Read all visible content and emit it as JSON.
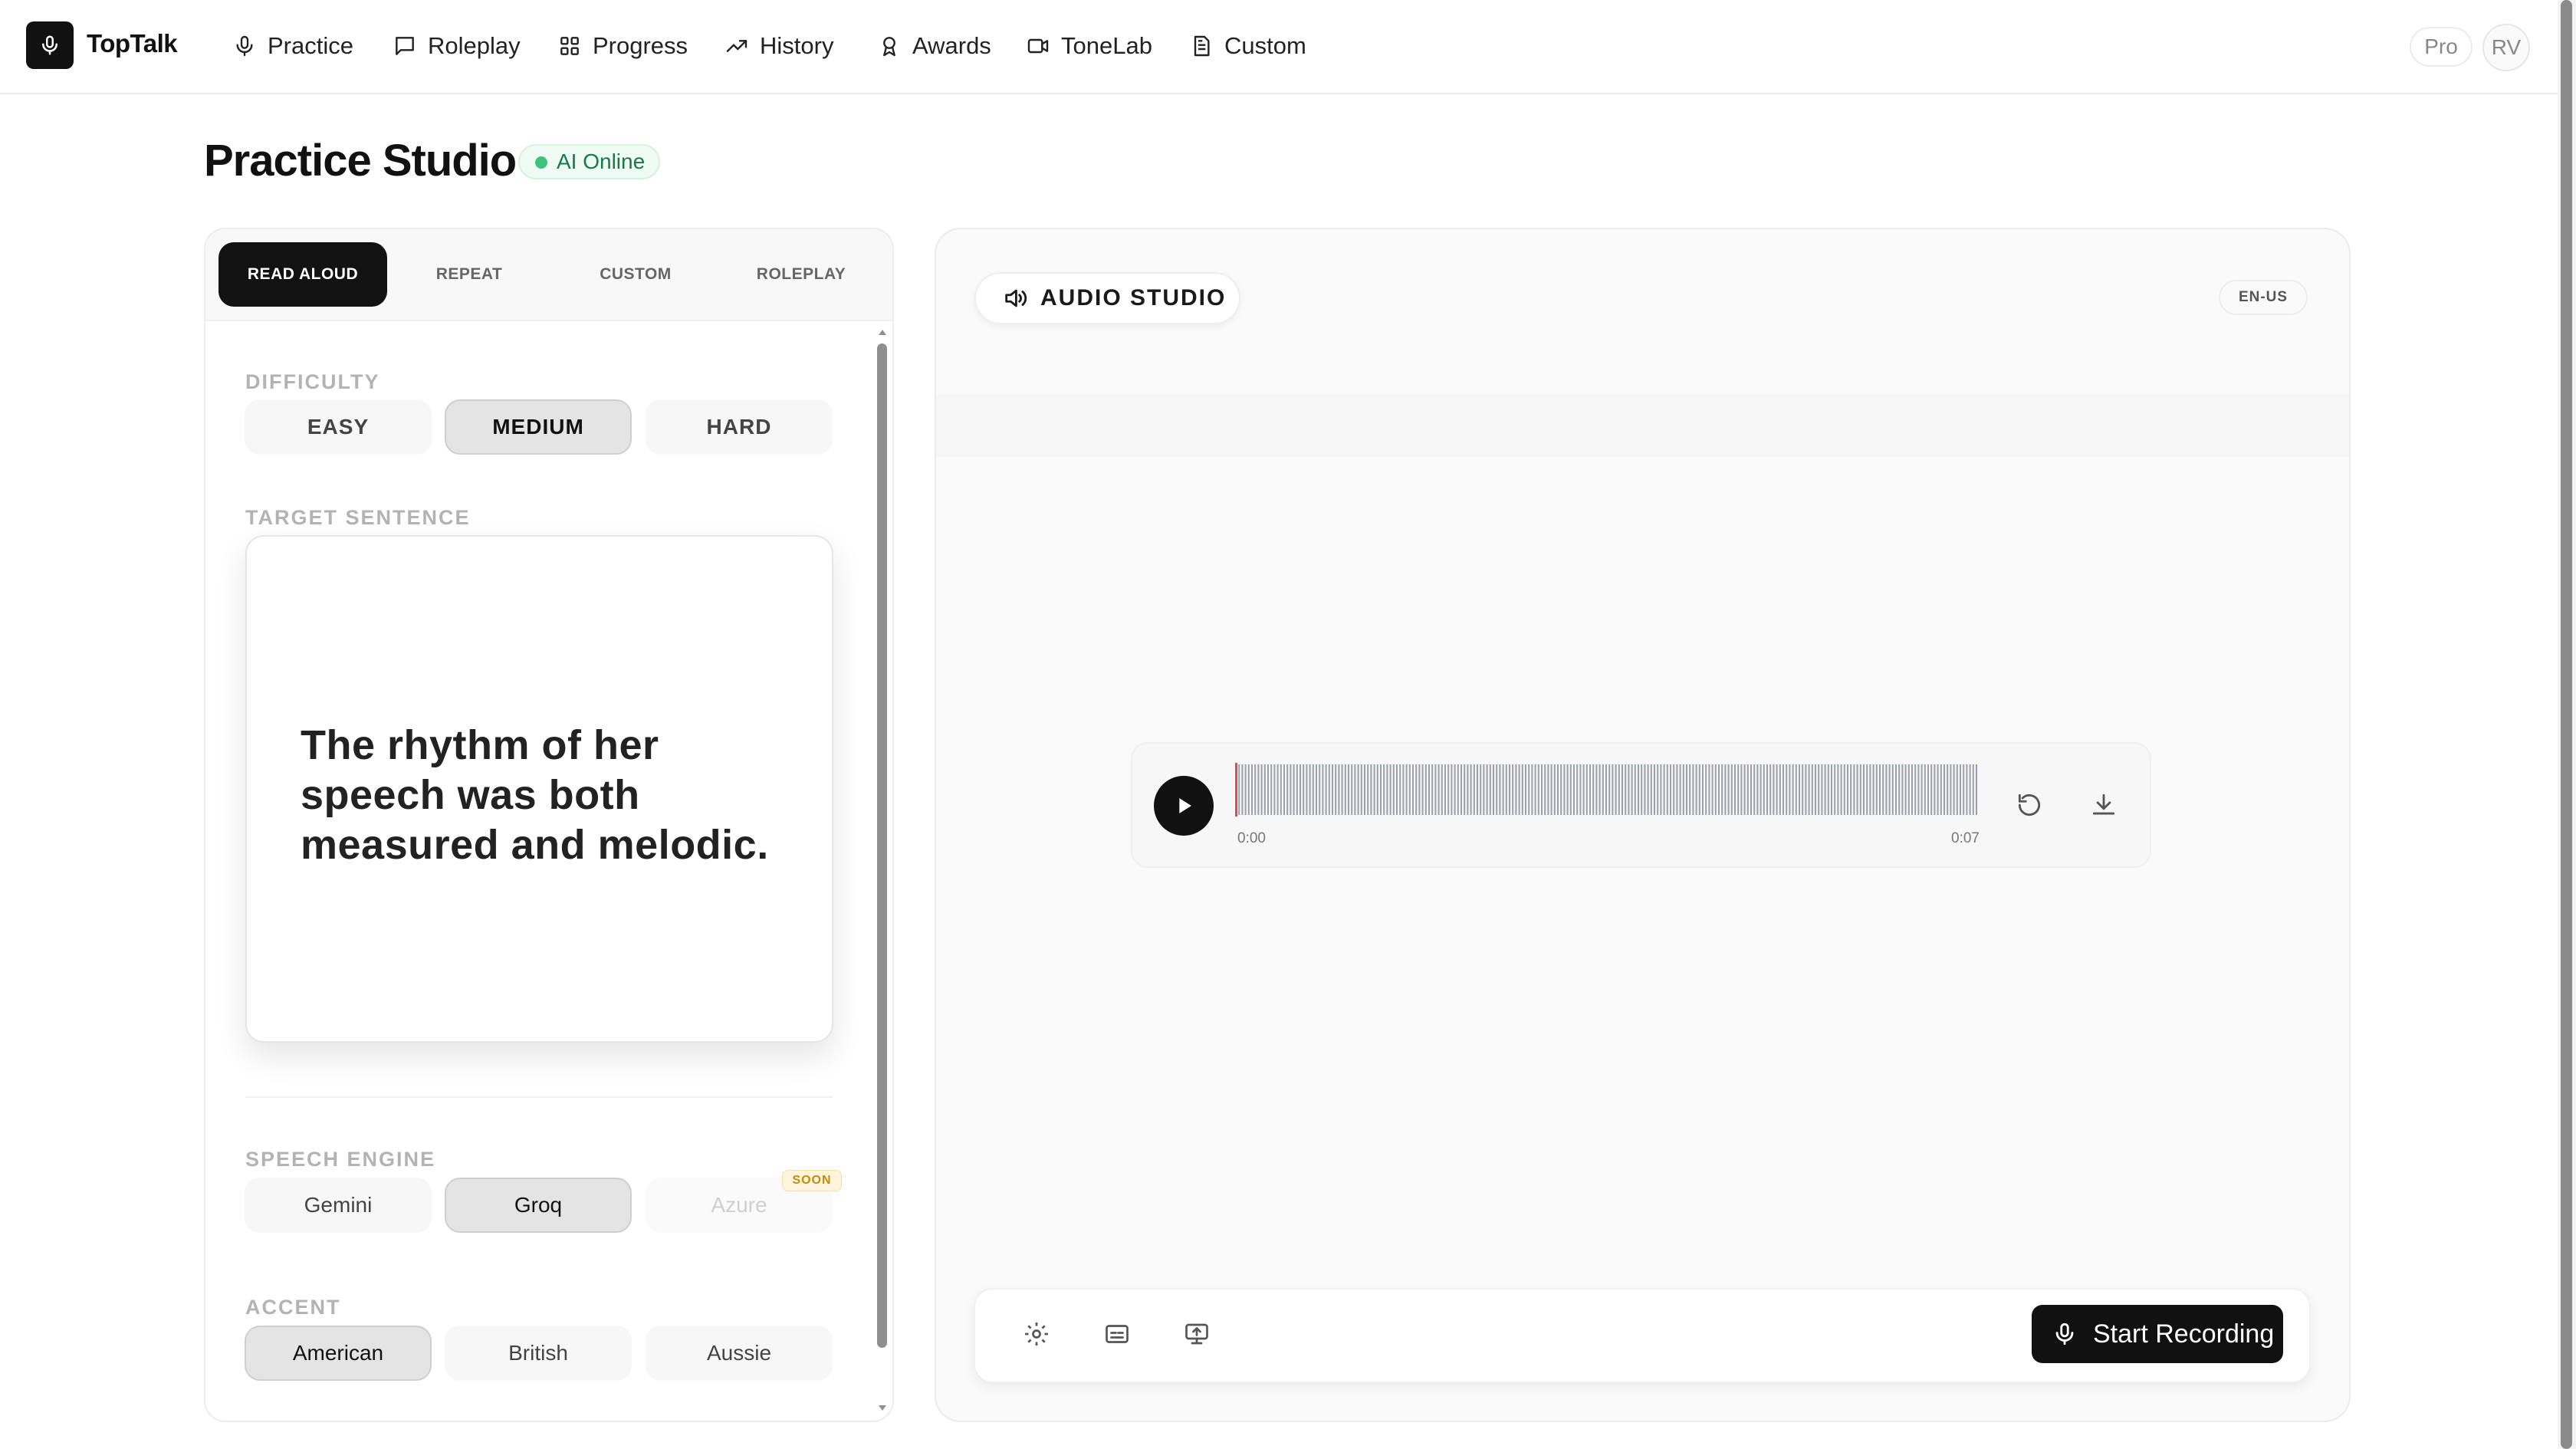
{
  "app": {
    "brand": "TopTalk",
    "nav": [
      {
        "label": "Practice",
        "icon": "mic-icon"
      },
      {
        "label": "Roleplay",
        "icon": "chat-icon"
      },
      {
        "label": "Progress",
        "icon": "grid-icon"
      },
      {
        "label": "History",
        "icon": "trend-icon"
      },
      {
        "label": "Awards",
        "icon": "award-icon"
      },
      {
        "label": "ToneLab",
        "icon": "video-icon"
      },
      {
        "label": "Custom",
        "icon": "document-icon"
      }
    ],
    "plan_badge": "Pro",
    "avatar_initials": "RV"
  },
  "page": {
    "title": "Practice Studio",
    "status": "AI Online"
  },
  "left_panel": {
    "tabs": [
      "READ ALOUD",
      "REPEAT",
      "CUSTOM",
      "ROLEPLAY"
    ],
    "active_tab": "READ ALOUD",
    "difficulty": {
      "label": "DIFFICULTY",
      "options": [
        "EASY",
        "MEDIUM",
        "HARD"
      ],
      "selected": "MEDIUM"
    },
    "target": {
      "label": "TARGET SENTENCE",
      "sentence": "The rhythm of her speech was both measured and melodic."
    },
    "engine": {
      "label": "SPEECH ENGINE",
      "options": [
        "Gemini",
        "Groq",
        "Azure"
      ],
      "selected": "Groq",
      "disabled": "Azure",
      "badge": "SOON"
    },
    "accent": {
      "label": "ACCENT",
      "options": [
        "American",
        "British",
        "Aussie"
      ],
      "selected": "American"
    }
  },
  "studio": {
    "title": "AUDIO STUDIO",
    "language": "EN-US",
    "player": {
      "time_start": "0:00",
      "time_end": "0:07",
      "progress": 0
    },
    "record_label": "Start Recording"
  },
  "colors": {
    "accent_dark": "#111111",
    "status_green": "#3cc47a",
    "playhead_red": "#e0484e",
    "wave_gray": "#9aa0aa"
  }
}
